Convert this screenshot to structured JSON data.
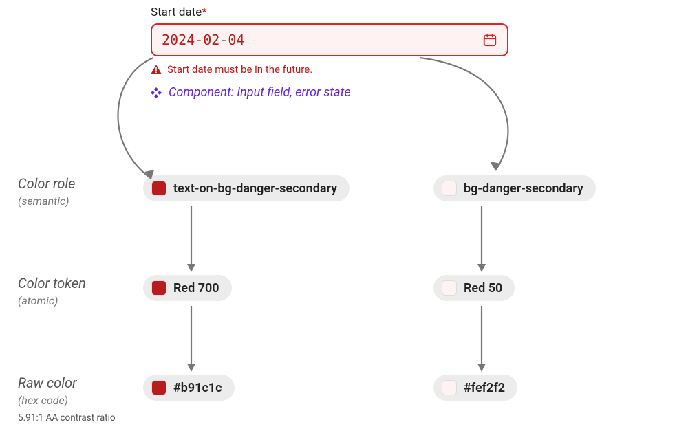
{
  "field": {
    "label": "Start date",
    "required_mark": "*",
    "value": "2024-02-04",
    "error": "Start date must be in the future.",
    "component_caption": "Component: Input field, error state"
  },
  "categories": {
    "role": {
      "title": "Color role",
      "sub": "(semantic)"
    },
    "token": {
      "title": "Color token",
      "sub": "(atomic)"
    },
    "raw": {
      "title": "Raw color",
      "sub": "(hex code)"
    }
  },
  "left_chain": {
    "role": {
      "label": "text-on-bg-danger-secondary",
      "swatch": "#b91c1c"
    },
    "token": {
      "label": "Red 700",
      "swatch": "#b91c1c"
    },
    "raw": {
      "label": "#b91c1c",
      "swatch": "#b91c1c"
    }
  },
  "right_chain": {
    "role": {
      "label": "bg-danger-secondary",
      "swatch": "#fef2f2"
    },
    "token": {
      "label": "Red 50",
      "swatch": "#fef2f2"
    },
    "raw": {
      "label": "#fef2f2",
      "swatch": "#fef2f2"
    }
  },
  "contrast_note": "5.91:1 AA contrast ratio"
}
